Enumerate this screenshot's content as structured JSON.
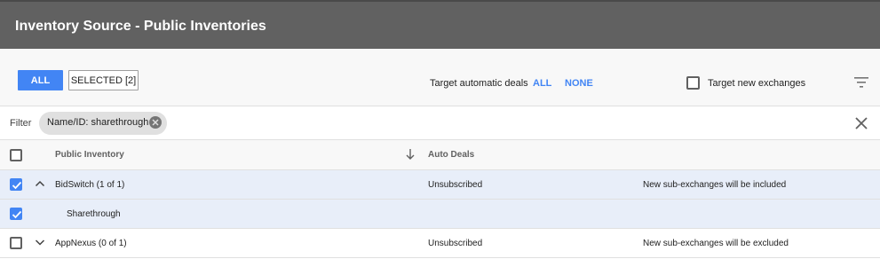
{
  "header": {
    "title": "Inventory Source - Public Inventories"
  },
  "toolbar": {
    "all_label": "ALL",
    "selected_label": "SELECTED [2]",
    "target_auto_label": "Target automatic deals",
    "auto_all_link": "ALL",
    "auto_none_link": "NONE",
    "target_new_label": "Target new exchanges",
    "target_new_checked": false,
    "filter_icon": "filter-icon"
  },
  "filter": {
    "label": "Filter",
    "chip_text": "Name/ID: sharethrough",
    "clear_icon": "close-icon"
  },
  "table": {
    "columns": [
      "Public Inventory",
      "Auto Deals"
    ],
    "sort_icon": "arrow-down-icon",
    "rows": [
      {
        "name": "BidSwitch (1 of 1)",
        "auto_deals": "Unsubscribed",
        "note": "New sub-exchanges will be included",
        "checked": true,
        "expanded": true
      },
      {
        "name": "Sharethrough",
        "auto_deals": "",
        "note": "",
        "checked": true,
        "child": true
      },
      {
        "name": "AppNexus (0 of 1)",
        "auto_deals": "Unsubscribed",
        "note": "New sub-exchanges will be excluded",
        "checked": false,
        "expanded": false
      }
    ]
  },
  "colors": {
    "header_bg": "#616161",
    "accent": "#4285f4",
    "selected_row": "#e8eef9"
  }
}
